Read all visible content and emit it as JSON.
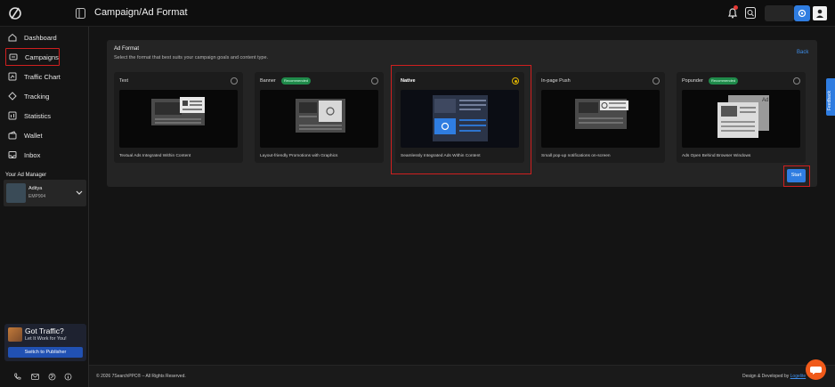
{
  "header": {
    "title": "Campaign/Ad Format"
  },
  "sidebar": {
    "items": [
      {
        "label": "Dashboard",
        "icon": "home-icon"
      },
      {
        "label": "Campaigns",
        "icon": "campaign-icon"
      },
      {
        "label": "Traffic Chart",
        "icon": "chart-icon"
      },
      {
        "label": "Tracking",
        "icon": "tracking-icon"
      },
      {
        "label": "Statistics",
        "icon": "statistics-icon"
      },
      {
        "label": "Wallet",
        "icon": "wallet-icon"
      },
      {
        "label": "Inbox",
        "icon": "inbox-icon"
      }
    ],
    "ad_manager": {
      "title": "Your Ad Manager",
      "name": "Aditya",
      "id": "EMP904"
    },
    "promo": {
      "title": "Got Traffic?",
      "subtitle": "Let It Work for You!",
      "button": "Switch to Publisher"
    }
  },
  "panel": {
    "title": "Ad Format",
    "subtitle": "Select the format that best suits your campaign goals and content type.",
    "back_label": "Back",
    "start_label": "Start"
  },
  "formats": [
    {
      "name": "Text",
      "badge": "",
      "desc": "Textual Ads Integrated Within Content",
      "selected": false
    },
    {
      "name": "Banner",
      "badge": "Recommended",
      "desc": "Layout-friendly Promotions with Graphics",
      "selected": false
    },
    {
      "name": "Native",
      "badge": "",
      "desc": "Seamlessly Integrated Ads Within Content",
      "selected": true
    },
    {
      "name": "In-page Push",
      "badge": "",
      "desc": "Small pop-up notifications on-screen",
      "selected": false
    },
    {
      "name": "Popunder",
      "badge": "Recommended",
      "desc": "Ads Open Behind Browser Windows",
      "selected": false
    }
  ],
  "popunder_preview_label": "Ad",
  "feedback_label": "Feedback",
  "footer": {
    "copyright": "© 2026 7SearchPPC® – All Rights Reserved.",
    "designed_prefix": "Design & Developed by",
    "designed_link": "Logelite"
  },
  "colors": {
    "accent": "#2f7de1",
    "highlight": "#d01f1f",
    "selected": "#e0b400",
    "badge": "#1f8a4a"
  }
}
